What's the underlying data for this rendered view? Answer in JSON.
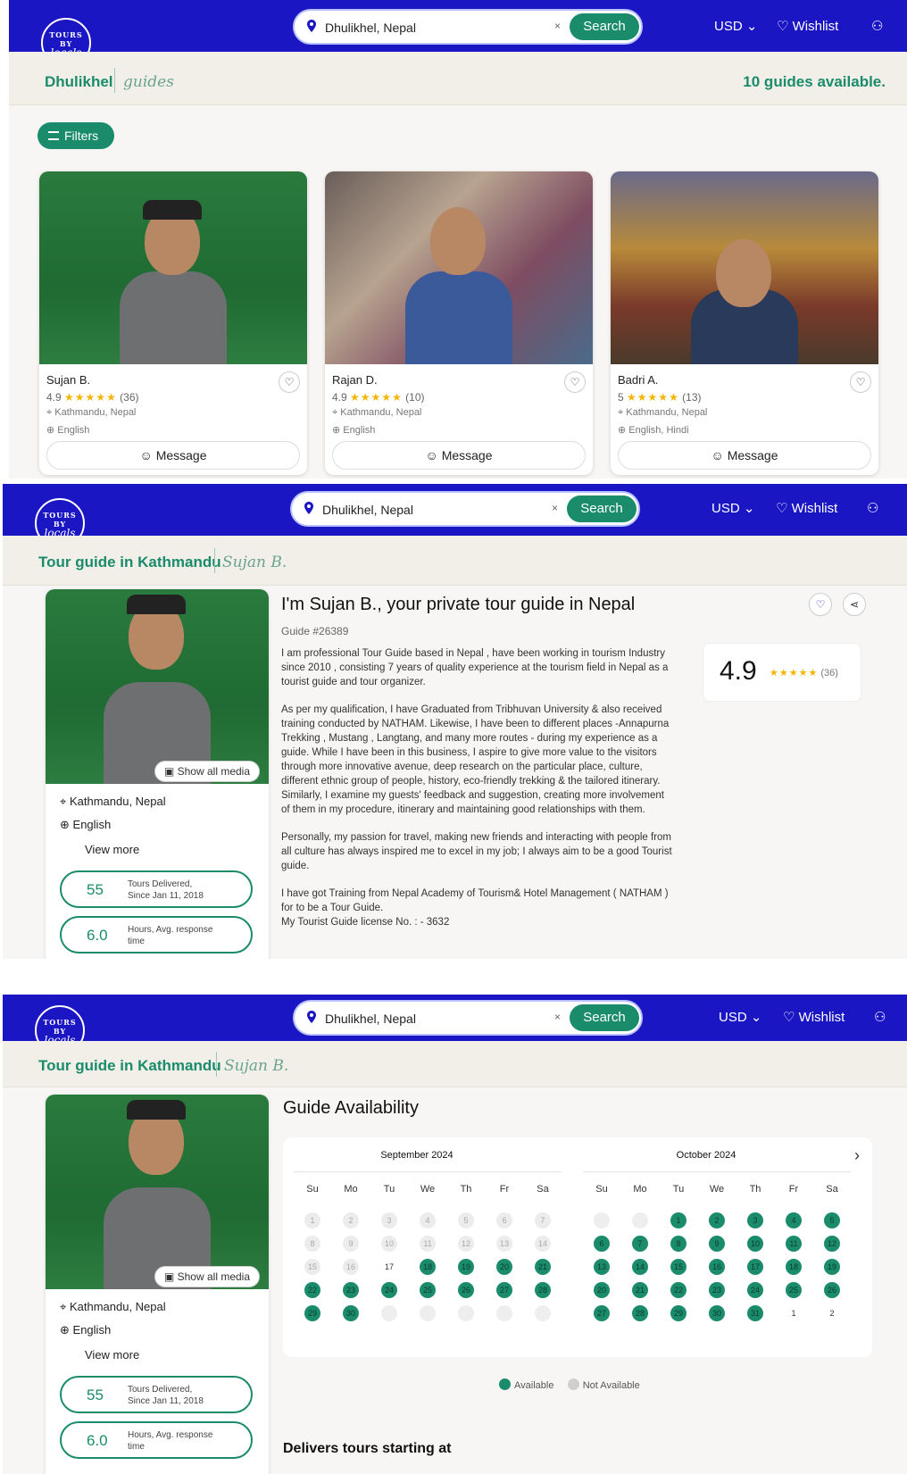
{
  "header": {
    "logo_top": "TOURS BY",
    "logo_bottom": "locals",
    "search_value": "Dhulikhel, Nepal",
    "search_clear": "×",
    "search_button": "Search",
    "currency": "USD",
    "wishlist": "Wishlist"
  },
  "panel1": {
    "crumb": "Dhulikhel",
    "crumb2": "guides",
    "count": "10 guides available.",
    "filters": "Filters",
    "guides": [
      {
        "name": "Sujan B.",
        "rating": "4.9",
        "stars": "★★★★★",
        "reviews": "(36)",
        "location": "Kathmandu, Nepal",
        "languages": "English",
        "message": "Message"
      },
      {
        "name": "Rajan D.",
        "rating": "4.9",
        "stars": "★★★★★",
        "reviews": "(10)",
        "location": "Kathmandu, Nepal",
        "languages": "English",
        "message": "Message"
      },
      {
        "name": "Badri A.",
        "rating": "5",
        "stars": "★★★★★",
        "reviews": "(13)",
        "location": "Kathmandu, Nepal",
        "languages": "English, Hindi",
        "message": "Message"
      }
    ]
  },
  "profile": {
    "crumb": "Tour guide in Kathmandu",
    "crumb2": "Sujan B.",
    "title": "I'm Sujan B., your private tour guide in Nepal",
    "guide_no": "Guide #26389",
    "show_media": "Show all media",
    "location": "Kathmandu, Nepal",
    "language": "English",
    "view_more": "View more",
    "stat1_num": "55",
    "stat1_label_a": "Tours Delivered,",
    "stat1_label_b": "Since Jan 11, 2018",
    "stat2_num": "6.0",
    "stat2_label_a": "Hours, Avg. response",
    "stat2_label_b": "time",
    "rating": "4.9",
    "rating_stars": "★★★★★",
    "rating_count": "(36)",
    "bio": [
      "I am professional Tour Guide based in Nepal , have been working in tourism Industry since 2010 , consisting 7 years of quality experience at the tourism field in Nepal as a tourist guide and tour organizer.",
      "As per my qualification, I have Graduated from Tribhuvan University & also received training conducted by NATHAM. Likewise, I have been to different places -Annapurna Trekking , Mustang , Langtang, and many more routes - during my experience as a guide. While I have been in this business, I aspire to give more value to the visitors through more innovative avenue, deep research on the particular place, culture, different ethnic group of people, history, eco-friendly trekking & the tailored itinerary. Similarly, I examine my guests' feedback and suggestion, creating more involvement of them in my procedure, itinerary and maintaining good relationships with them.",
      "Personally, my passion for travel, making new friends and interacting with people from all culture has always inspired me to excel in my job; I always aim to be a good Tourist guide.",
      "I have got Training from Nepal Academy of Tourism& Hotel Management ( NATHAM ) for to be a Tour Guide.\nMy Tourist Guide license No. : - 3632"
    ]
  },
  "availability": {
    "title": "Guide Availability",
    "month1": "September 2024",
    "month2": "October 2024",
    "dows": [
      "Su",
      "Mo",
      "Tu",
      "We",
      "Th",
      "Fr",
      "Sa"
    ],
    "legend_available": "Available",
    "legend_not": "Not Available",
    "delivers": "Delivers tours starting at",
    "colors": {
      "available": "#1a8c6b",
      "not_available": "#cfcfcf"
    }
  }
}
